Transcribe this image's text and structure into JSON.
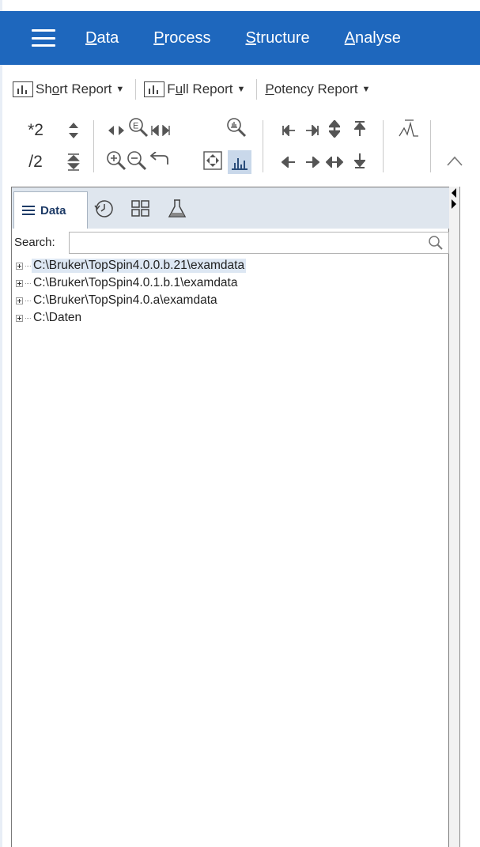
{
  "menu": {
    "items": [
      {
        "label": "Data",
        "mnemonic": "D",
        "rest": "ata"
      },
      {
        "label": "Process",
        "mnemonic": "P",
        "rest": "rocess"
      },
      {
        "label": "Structure",
        "mnemonic": "S",
        "rest": "tructure"
      },
      {
        "label": "Analyse",
        "mnemonic": "A",
        "rest": "nalyse"
      }
    ]
  },
  "reports": {
    "short": {
      "pre": "Sh",
      "mn": "o",
      "post": "rt Report"
    },
    "full": {
      "pre": "F",
      "mn": "u",
      "post": "ll Report"
    },
    "potency": {
      "pre": "",
      "mn": "P",
      "post": "otency Report"
    }
  },
  "toolbar": {
    "scale_up": "*2",
    "scale_down": "/2"
  },
  "panel": {
    "tabs": {
      "data_label": "Data"
    },
    "search_label": "Search:",
    "search_value": "",
    "tree": [
      {
        "label": "C:\\Bruker\\TopSpin4.0.0.b.21\\examdata",
        "selected": true
      },
      {
        "label": "C:\\Bruker\\TopSpin4.0.1.b.1\\examdata",
        "selected": false
      },
      {
        "label": "C:\\Bruker\\TopSpin4.0.a\\examdata",
        "selected": false
      },
      {
        "label": "C:\\Daten",
        "selected": false
      }
    ]
  },
  "colors": {
    "menubar": "#1e67bd",
    "tab_bar": "#dfe6ee",
    "selection": "#dde7f3"
  }
}
